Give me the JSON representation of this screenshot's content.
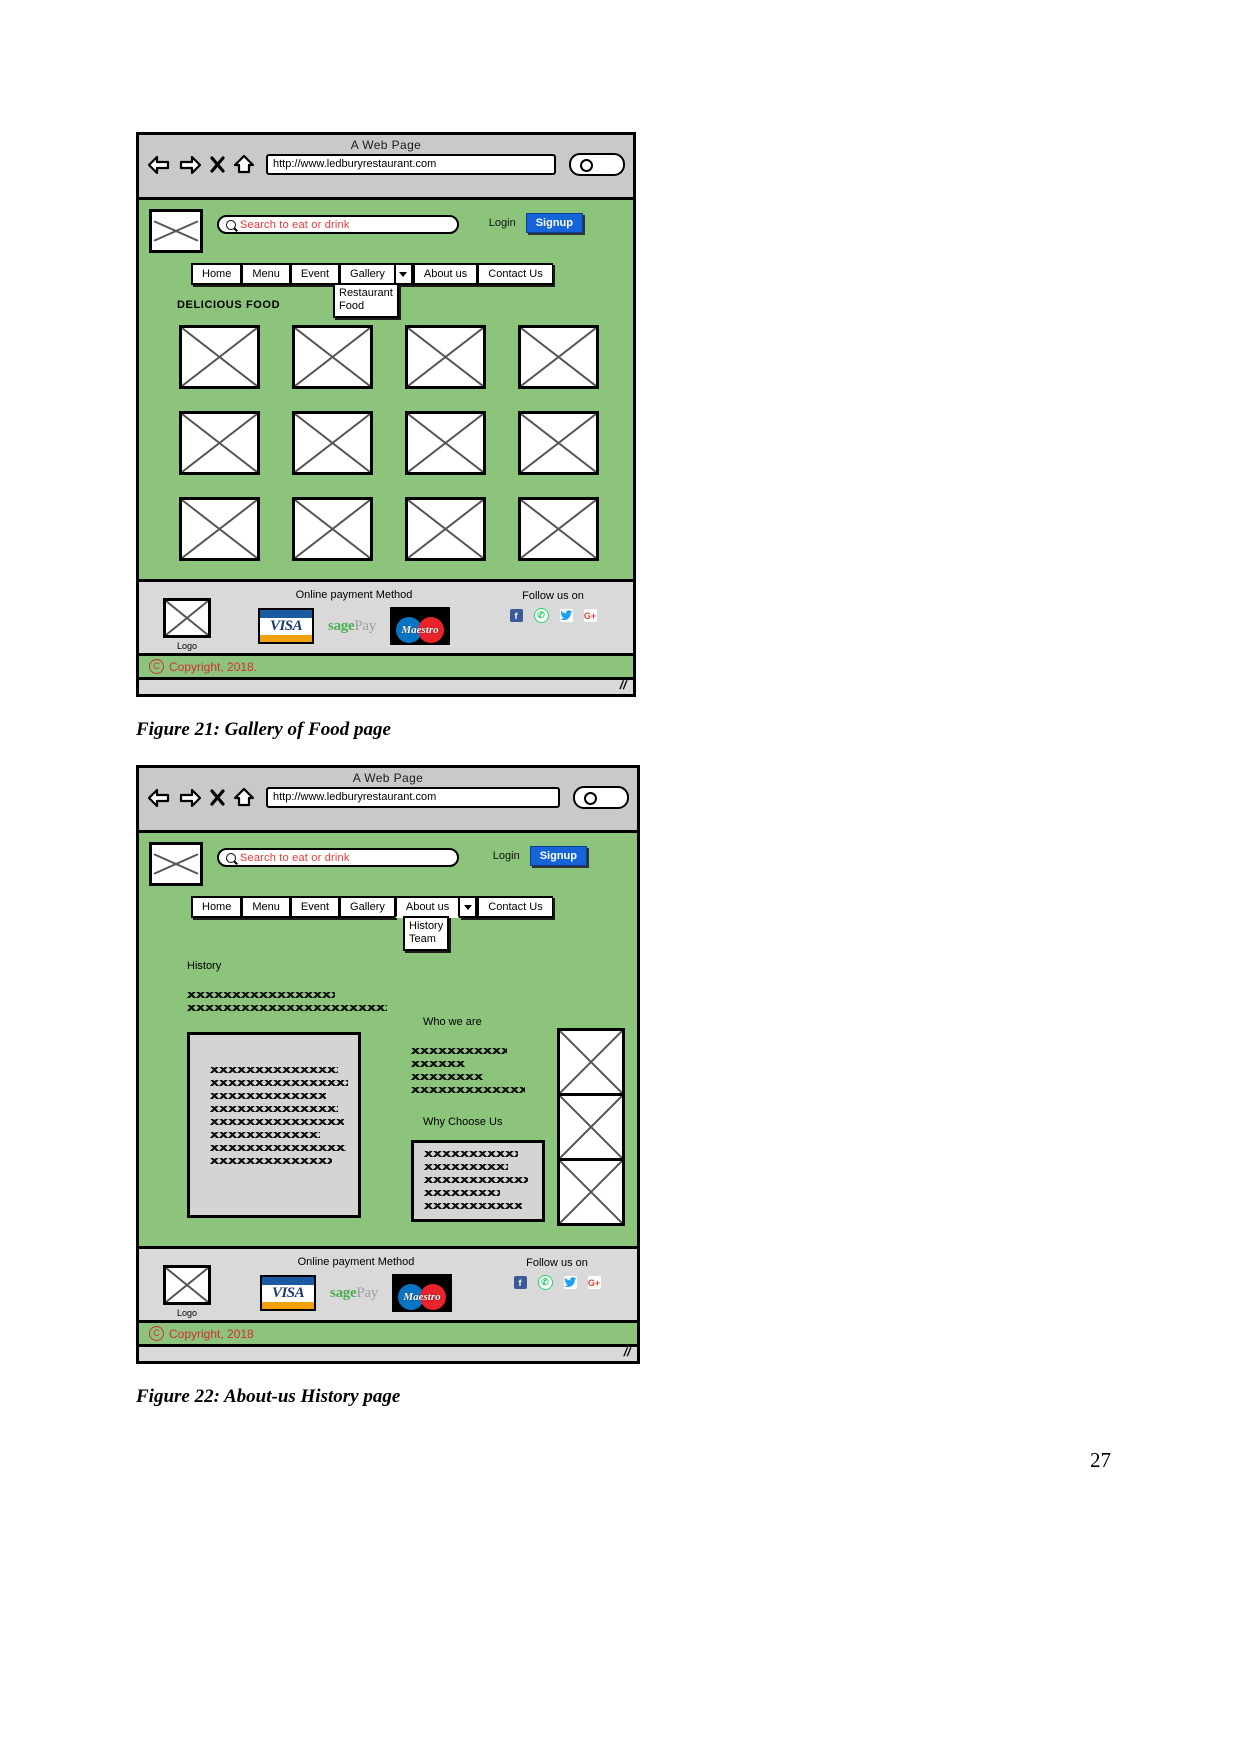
{
  "document": {
    "page_number": "27"
  },
  "figures": [
    {
      "caption": "Figure 21: Gallery of Food page",
      "browser": {
        "title": "A Web Page",
        "url": "http://www.ledburyrestaurant.com",
        "icons": [
          "back-arrow-icon",
          "forward-arrow-icon",
          "close-icon",
          "home-icon",
          "browser-search-icon"
        ]
      },
      "site": {
        "logo_alt": "logo-placeholder",
        "search": {
          "placeholder": "Search to eat or drink",
          "value": ""
        },
        "auth": {
          "login_label": "Login",
          "signup_label": "Signup",
          "signup_color": "#1565d8"
        },
        "nav": {
          "items": [
            "Home",
            "Menu",
            "Event",
            "Gallery",
            "About us",
            "Contact Us"
          ],
          "active": "Gallery",
          "dropdown": {
            "parent": "Gallery",
            "items": [
              "Restaurant",
              "Food"
            ]
          }
        },
        "section_title": "DELICIOUS FOOD",
        "gallery": {
          "rows": 3,
          "cols": 4,
          "cells": [
            "food-thumb-1",
            "food-thumb-2",
            "food-thumb-3",
            "food-thumb-4",
            "food-thumb-5",
            "food-thumb-6",
            "food-thumb-7",
            "food-thumb-8",
            "food-thumb-9",
            "food-thumb-10",
            "food-thumb-11",
            "food-thumb-12"
          ]
        }
      },
      "footer": {
        "logo_label": "Logo",
        "payment_title": "Online payment Method",
        "payments": [
          "VISA",
          "sage Pay",
          "Maestro"
        ],
        "visa_label": "VISA",
        "sagepay_label_1": "sage",
        "sagepay_label_2": "Pay",
        "maestro_label": "Maestro",
        "social_title": "Follow us on",
        "social": [
          "facebook-icon",
          "whatsapp-icon",
          "twitter-icon",
          "google-plus-icon"
        ],
        "social_glyphs": [
          "f",
          "✆",
          "ᵗ",
          "G+"
        ],
        "copyright": "Copyright, 2018.",
        "copyright_symbol": "C",
        "copyright_color": "#d32f2f"
      }
    },
    {
      "caption": "Figure 22: About-us History page",
      "browser": {
        "title": "A Web Page",
        "url": "http://www.ledburyrestaurant.com",
        "icons": [
          "back-arrow-icon",
          "forward-arrow-icon",
          "close-icon",
          "home-icon",
          "browser-search-icon"
        ]
      },
      "site": {
        "logo_alt": "logo-placeholder",
        "search": {
          "placeholder": "Search to eat or drink",
          "value": ""
        },
        "auth": {
          "login_label": "Login",
          "signup_label": "Signup",
          "signup_color": "#1565d8"
        },
        "nav": {
          "items": [
            "Home",
            "Menu",
            "Event",
            "Gallery",
            "About us",
            "Contact Us"
          ],
          "active": "About us",
          "dropdown": {
            "parent": "About us",
            "items": [
              "History",
              "Team"
            ]
          }
        },
        "content": {
          "history_heading": "History",
          "who_heading": "Who we are",
          "why_heading": "Why Choose Us",
          "history_intro_lines": 2,
          "history_card_lines": 8,
          "who_lines": 4,
          "why_card_lines": 5,
          "side_images": [
            "about-image-1",
            "about-image-2",
            "about-image-3"
          ]
        }
      },
      "footer": {
        "logo_label": "Logo",
        "payment_title": "Online payment Method",
        "payments": [
          "VISA",
          "sage Pay",
          "Maestro"
        ],
        "visa_label": "VISA",
        "sagepay_label_1": "sage",
        "sagepay_label_2": "Pay",
        "maestro_label": "Maestro",
        "social_title": "Follow us on",
        "social": [
          "facebook-icon",
          "whatsapp-icon",
          "twitter-icon",
          "google-plus-icon"
        ],
        "social_glyphs": [
          "f",
          "✆",
          "ᵗ",
          "G+"
        ],
        "copyright": "Copyright, 2018",
        "copyright_symbol": "C",
        "copyright_color": "#d32f2f"
      }
    }
  ]
}
